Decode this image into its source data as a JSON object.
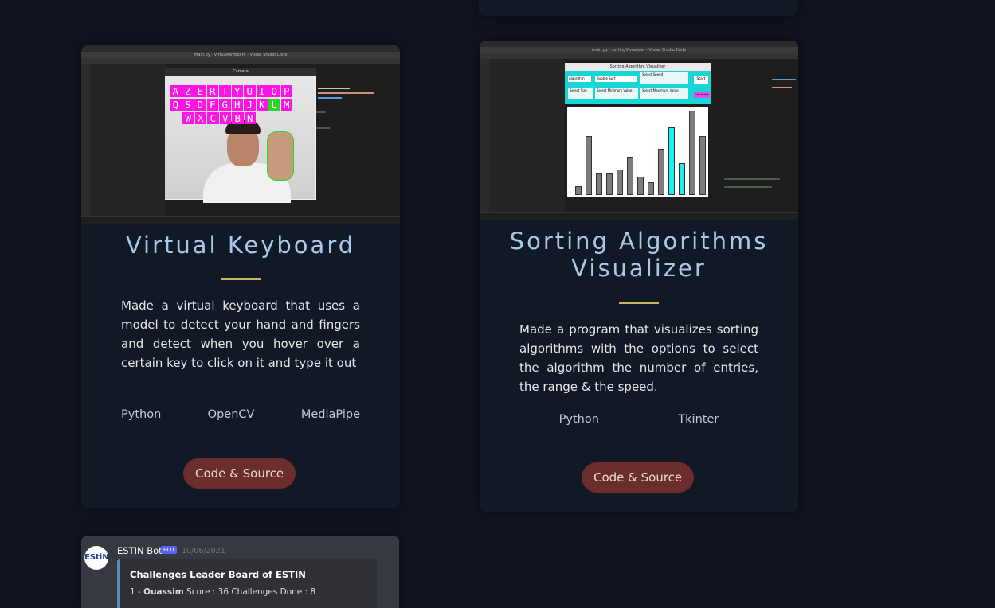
{
  "cards": [
    {
      "id": "virtual-keyboard",
      "title": "Virtual Keyboard",
      "description": "Made a virtual keyboard that uses a model to detect your hand and fingers and detect when you hover over a certain key to click on it and type it out",
      "tags": [
        "Python",
        "OpenCV",
        "MediaPipe"
      ],
      "button": "Code & Source",
      "screenshot": {
        "window_title": "main.py - VirtualKeyboard - Visual Studio Code",
        "camera_title": "Camera",
        "key_rows": [
          [
            "A",
            "Z",
            "E",
            "R",
            "T",
            "Y",
            "U",
            "I",
            "O",
            "P"
          ],
          [
            "Q",
            "S",
            "D",
            "F",
            "G",
            "H",
            "J",
            "K",
            "L",
            "M"
          ],
          [
            "W",
            "X",
            "C",
            "V",
            "B",
            "N"
          ]
        ],
        "highlighted_key": "L"
      }
    },
    {
      "id": "sorting-visualizer",
      "title": "Sorting Algorithms Visualizer",
      "description": "Made a program that visualizes sorting algorithms with the options to select the algorithm the number of entries, the range & the speed.",
      "tags": [
        "Python",
        "Tkinter"
      ],
      "button": "Code & Source",
      "screenshot": {
        "window_title": "main.py - sortingVisualizer - Visual Studio Code",
        "app_title": "Sorting Algorithm Visualizer",
        "algorithm_label": "Algorithm :",
        "algorithm_value": "Bubble Sort",
        "speed_label": "Select Speed",
        "start_label": "Start",
        "size_label": "Select Size",
        "min_label": "Select Minimum Value",
        "max_label": "Select Maximum Value",
        "generate_label": "Generate",
        "bars": [
          10,
          70,
          25,
          25,
          30,
          45,
          22,
          15,
          55,
          80,
          38,
          100,
          70
        ],
        "highlighted_bars": [
          9,
          10
        ]
      }
    }
  ],
  "discord": {
    "avatar": "EStiN",
    "bot_name": "ESTIN Bot",
    "badge": "BOT",
    "date": "10/06/2021",
    "embed_title": "Challenges Leader Board of ESTIN",
    "rank": "1 - ",
    "user": "Ouassim",
    "entry_rest": " Score : 36 Challenges Done : 8"
  },
  "colors": {
    "background": "#0f1420",
    "card": "#111826",
    "title": "#a9c8e8",
    "divider": "#c9b65a",
    "button": "#6b2e2c"
  }
}
